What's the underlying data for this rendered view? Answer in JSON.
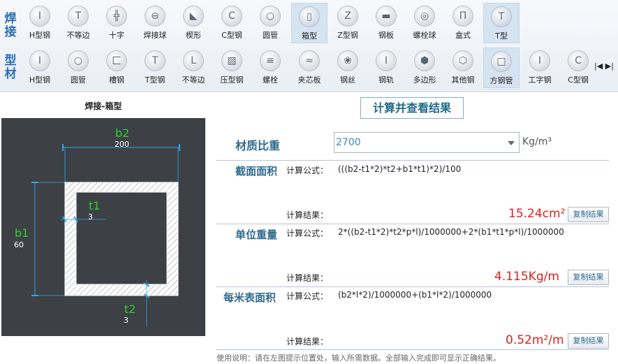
{
  "toolbar": {
    "row1_label": "焊接",
    "row2_label": "型材",
    "row1": [
      {
        "label": "H型钢",
        "icon": "I"
      },
      {
        "label": "不等边",
        "icon": "T"
      },
      {
        "label": "十字",
        "icon": "╬"
      },
      {
        "label": "焊接球",
        "icon": "⊖"
      },
      {
        "label": "楔形",
        "icon": "◣"
      },
      {
        "label": "C型钢",
        "icon": "C"
      },
      {
        "label": "圆管",
        "icon": "○"
      },
      {
        "label": "箱型",
        "icon": "▯"
      },
      {
        "label": "Z型钢",
        "icon": "Z"
      },
      {
        "label": "钢板",
        "icon": "▬"
      },
      {
        "label": "螺栓球",
        "icon": "◎"
      },
      {
        "label": "盒式",
        "icon": "Π"
      },
      {
        "label": "T型",
        "icon": "T"
      }
    ],
    "row2": [
      {
        "label": "H型钢",
        "icon": "I"
      },
      {
        "label": "圆管",
        "icon": "○"
      },
      {
        "label": "槽钢",
        "icon": "匚"
      },
      {
        "label": "T型钢",
        "icon": "T"
      },
      {
        "label": "不等边",
        "icon": "L"
      },
      {
        "label": "压型钢",
        "icon": "▨"
      },
      {
        "label": "螺栓",
        "icon": "≡"
      },
      {
        "label": "夹芯板",
        "icon": "≈"
      },
      {
        "label": "钢丝",
        "icon": "❀"
      },
      {
        "label": "钢轨",
        "icon": "I"
      },
      {
        "label": "多边形",
        "icon": "⬢"
      },
      {
        "label": "其他钢",
        "icon": "⬡"
      },
      {
        "label": "方钢管",
        "icon": "□"
      },
      {
        "label": "工字钢",
        "icon": "I"
      },
      {
        "label": "C型钢",
        "icon": "C"
      }
    ],
    "scroll_arrows": "|◀ ▶|"
  },
  "panel": {
    "title": "焊接-箱型",
    "dims": {
      "b2": {
        "name": "b2",
        "value": "200"
      },
      "b1": {
        "name": "b1",
        "value": "60"
      },
      "t1": {
        "name": "t1",
        "value": "3"
      },
      "t2": {
        "name": "t2",
        "value": "3"
      }
    }
  },
  "calc_button": "计算并查看结果",
  "material": {
    "label": "材质比重",
    "value": "2700",
    "unit": "Kg/m³"
  },
  "sections": [
    {
      "label": "截面面积",
      "formula_label": "计算公式：",
      "formula": "(((b2-t1*2)*t2+b1*t1)*2)/100",
      "result_label": "计算结果：",
      "result": "15.24cm²",
      "copy": "复制结果"
    },
    {
      "label": "单位重量",
      "formula_label": "计算公式：",
      "formula": "2*((b2-t1*2)*t2*p*l)/1000000+2*(b1*t1*p*l)/1000000",
      "result_label": "计算结果：",
      "result": "4.115Kg/m",
      "copy": "复制结果"
    },
    {
      "label": "每米表面积",
      "formula_label": "计算公式：",
      "formula": "(b2*l*2)/1000000+(b1*l*2)/1000000",
      "result_label": "计算结果：",
      "result": "0.52m²/m",
      "copy": "复制结果"
    }
  ],
  "footer": "使用说明：请在左图提示位置处，输入所需数据。全部输入完成即可显示正确结果。",
  "colors": {
    "accent": "#2f6a90",
    "result": "#e0201e",
    "dim_label": "#2fd02f",
    "canvas_bg": "#3d4045"
  }
}
